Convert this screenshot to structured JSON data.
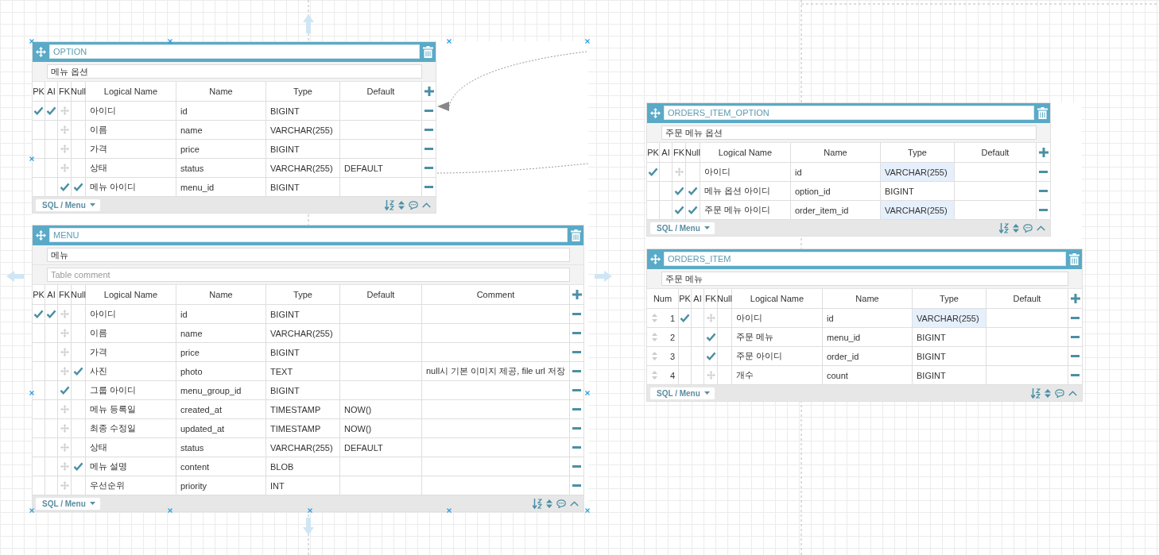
{
  "tables": [
    {
      "name": "OPTION",
      "comment": "메뉴 옵션",
      "columns": [
        {
          "label": "PK",
          "kind": "pk"
        },
        {
          "label": "AI",
          "kind": "ai"
        },
        {
          "label": "FK",
          "kind": "fk"
        },
        {
          "label": "Null",
          "kind": "null"
        },
        {
          "label": "Logical Name",
          "kind": "logical"
        },
        {
          "label": "Name",
          "kind": "name"
        },
        {
          "label": "Type",
          "kind": "type"
        },
        {
          "label": "Default",
          "kind": "default"
        }
      ],
      "fields": [
        {
          "pk": true,
          "ai": true,
          "fk": false,
          "null": false,
          "logical_name": "아이디",
          "name": "id",
          "type": "BIGINT"
        },
        {
          "pk": false,
          "ai": false,
          "fk": false,
          "null": false,
          "logical_name": "이름",
          "name": "name",
          "type": "VARCHAR(255)"
        },
        {
          "pk": false,
          "ai": false,
          "fk": false,
          "null": false,
          "logical_name": "가격",
          "name": "price",
          "type": "BIGINT"
        },
        {
          "pk": false,
          "ai": false,
          "fk": false,
          "null": false,
          "logical_name": "상태",
          "name": "status",
          "type": "VARCHAR(255)",
          "default": "DEFAULT"
        },
        {
          "pk": false,
          "ai": false,
          "fk": true,
          "null": true,
          "logical_name": "메뉴 아이디",
          "name": "menu_id",
          "type": "BIGINT"
        }
      ],
      "footer_menu": "SQL / Menu"
    },
    {
      "name": "MENU",
      "comment": "메뉴",
      "table_comment": {
        "placeholder": "Table comment"
      },
      "columns": [
        {
          "label": "PK",
          "kind": "pk"
        },
        {
          "label": "AI",
          "kind": "ai"
        },
        {
          "label": "FK",
          "kind": "fk"
        },
        {
          "label": "Null",
          "kind": "null"
        },
        {
          "label": "Logical Name",
          "kind": "logical"
        },
        {
          "label": "Name",
          "kind": "name"
        },
        {
          "label": "Type",
          "kind": "type"
        },
        {
          "label": "Default",
          "kind": "default"
        },
        {
          "label": "Comment",
          "kind": "comment"
        }
      ],
      "fields": [
        {
          "pk": true,
          "ai": true,
          "fk": false,
          "null": false,
          "logical_name": "아이디",
          "name": "id",
          "type": "BIGINT"
        },
        {
          "pk": false,
          "ai": false,
          "fk": false,
          "null": false,
          "logical_name": "이름",
          "name": "name",
          "type": "VARCHAR(255)"
        },
        {
          "pk": false,
          "ai": false,
          "fk": false,
          "null": false,
          "logical_name": "가격",
          "name": "price",
          "type": "BIGINT"
        },
        {
          "pk": false,
          "ai": false,
          "fk": false,
          "null": true,
          "logical_name": "사진",
          "name": "photo",
          "type": "TEXT",
          "comment": "null시 기본 이미지 제공, file url 저장"
        },
        {
          "pk": false,
          "ai": false,
          "fk": true,
          "null": false,
          "logical_name": "그룹 아이디",
          "name": "menu_group_id",
          "type": "BIGINT"
        },
        {
          "pk": false,
          "ai": false,
          "fk": false,
          "null": false,
          "logical_name": "메뉴 등록일",
          "name": "created_at",
          "type": "TIMESTAMP",
          "default": "NOW()"
        },
        {
          "pk": false,
          "ai": false,
          "fk": false,
          "null": false,
          "logical_name": "최종 수정일",
          "name": "updated_at",
          "type": "TIMESTAMP",
          "default": "NOW()"
        },
        {
          "pk": false,
          "ai": false,
          "fk": false,
          "null": false,
          "logical_name": "상태",
          "name": "status",
          "type": "VARCHAR(255)",
          "default": "DEFAULT"
        },
        {
          "pk": false,
          "ai": false,
          "fk": false,
          "null": true,
          "logical_name": "메뉴 설명",
          "name": "content",
          "type": "BLOB"
        },
        {
          "pk": false,
          "ai": false,
          "fk": false,
          "null": false,
          "logical_name": "우선순위",
          "name": "priority",
          "type": "INT"
        }
      ],
      "footer_menu": "SQL / Menu"
    },
    {
      "name": "ORDERS_ITEM_OPTION",
      "comment": "주문 메뉴 옵션",
      "columns": [
        {
          "label": "PK",
          "kind": "pk"
        },
        {
          "label": "AI",
          "kind": "ai"
        },
        {
          "label": "FK",
          "kind": "fk"
        },
        {
          "label": "Null",
          "kind": "null"
        },
        {
          "label": "Logical Name",
          "kind": "logical"
        },
        {
          "label": "Name",
          "kind": "name"
        },
        {
          "label": "Type",
          "kind": "type"
        },
        {
          "label": "Default",
          "kind": "default"
        }
      ],
      "fields": [
        {
          "pk": true,
          "ai": false,
          "fk": false,
          "null": false,
          "logical_name": "아이디",
          "name": "id",
          "type": "VARCHAR(255)",
          "highlighted": true
        },
        {
          "pk": false,
          "ai": false,
          "fk": true,
          "null": true,
          "logical_name": "메뉴 옵션 아이디",
          "name": "option_id",
          "type": "BIGINT",
          "highlighted": false
        },
        {
          "pk": false,
          "ai": false,
          "fk": true,
          "null": true,
          "logical_name": "주문 메뉴 아이디",
          "name": "order_item_id",
          "type": "VARCHAR(255)",
          "highlighted": true
        }
      ],
      "footer_menu": "SQL / Menu"
    },
    {
      "name": "ORDERS_ITEM",
      "comment": "주문 메뉴",
      "columns": [
        {
          "label": "Num",
          "kind": "num"
        },
        {
          "label": "PK",
          "kind": "pk"
        },
        {
          "label": "AI",
          "kind": "ai"
        },
        {
          "label": "FK",
          "kind": "fk"
        },
        {
          "label": "Null",
          "kind": "null"
        },
        {
          "label": "Logical Name",
          "kind": "logical"
        },
        {
          "label": "Name",
          "kind": "name"
        },
        {
          "label": "Type",
          "kind": "type"
        },
        {
          "label": "Default",
          "kind": "default"
        }
      ],
      "fields": [
        {
          "num": "1",
          "pk": true,
          "ai": false,
          "fk": false,
          "null": false,
          "logical_name": "아이디",
          "name": "id",
          "type": "VARCHAR(255)",
          "highlighted": true
        },
        {
          "num": "2",
          "pk": false,
          "ai": false,
          "fk": true,
          "null": false,
          "logical_name": "주문 메뉴",
          "name": "menu_id",
          "type": "BIGINT",
          "highlighted": false
        },
        {
          "num": "3",
          "pk": false,
          "ai": false,
          "fk": true,
          "null": false,
          "logical_name": "주문 아이디",
          "name": "order_id",
          "type": "BIGINT",
          "highlighted": false
        },
        {
          "num": "4",
          "pk": false,
          "ai": false,
          "fk": false,
          "null": false,
          "logical_name": "개수",
          "name": "count",
          "type": "BIGINT",
          "highlighted": false
        }
      ],
      "footer_menu": "SQL / Menu"
    }
  ]
}
